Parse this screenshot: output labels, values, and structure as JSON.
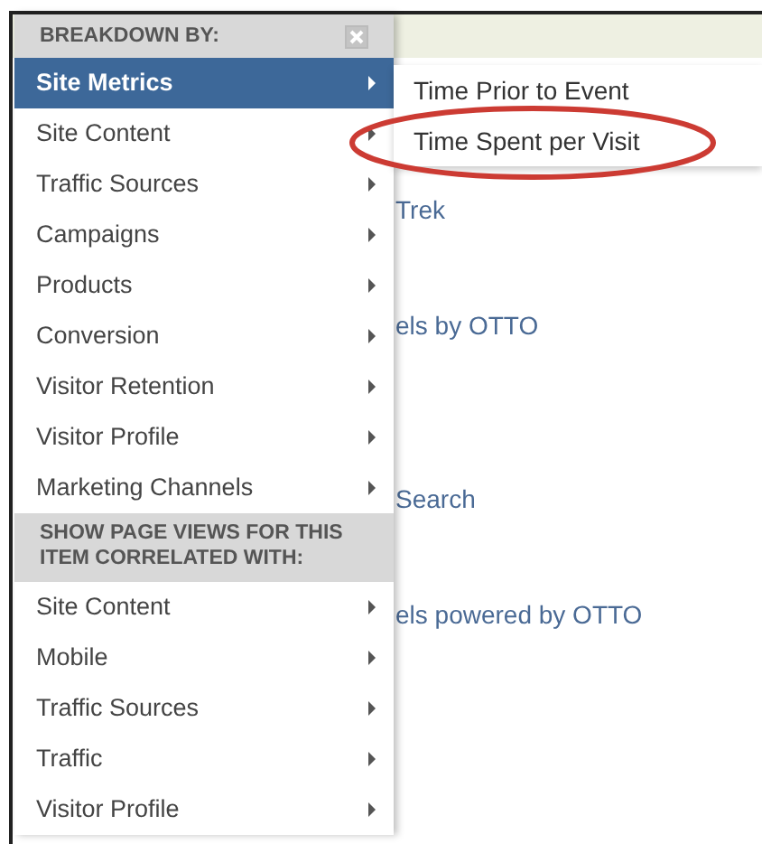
{
  "page_links": [
    "Trek",
    "els by OTTO",
    "Search",
    "els powered by OTTO"
  ],
  "menu": {
    "sections": [
      {
        "title": "BREAKDOWN BY:",
        "closable": true,
        "items": [
          {
            "label": "Site Metrics",
            "selected": true
          },
          {
            "label": "Site Content",
            "selected": false
          },
          {
            "label": "Traffic Sources",
            "selected": false
          },
          {
            "label": "Campaigns",
            "selected": false
          },
          {
            "label": "Products",
            "selected": false
          },
          {
            "label": "Conversion",
            "selected": false
          },
          {
            "label": "Visitor Retention",
            "selected": false
          },
          {
            "label": "Visitor Profile",
            "selected": false
          },
          {
            "label": "Marketing Channels",
            "selected": false
          }
        ]
      },
      {
        "title": "SHOW PAGE VIEWS FOR THIS ITEM CORRELATED WITH:",
        "closable": false,
        "items": [
          {
            "label": "Site Content",
            "selected": false
          },
          {
            "label": "Mobile",
            "selected": false
          },
          {
            "label": "Traffic Sources",
            "selected": false
          },
          {
            "label": "Traffic",
            "selected": false
          },
          {
            "label": "Visitor Profile",
            "selected": false
          }
        ]
      }
    ]
  },
  "submenu": {
    "items": [
      "Time Prior to Event",
      "Time Spent per Visit"
    ]
  },
  "highlight": {
    "kind": "ellipse",
    "color": "#cc3b33"
  }
}
